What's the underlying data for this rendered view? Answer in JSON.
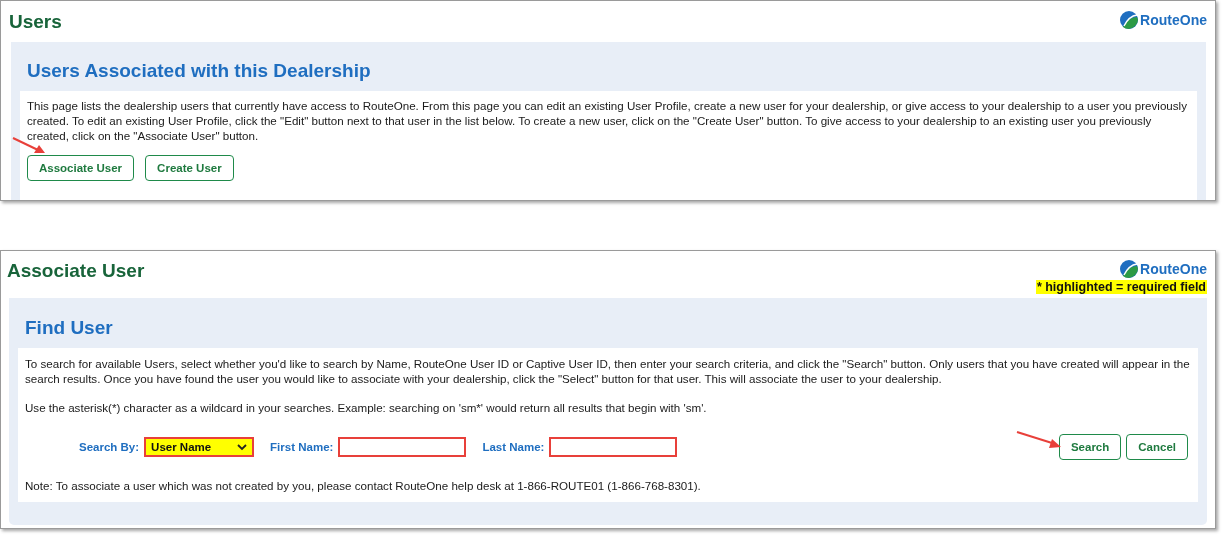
{
  "users_panel": {
    "title": "Users",
    "brand": "RouteOne",
    "section_title": "Users Associated with this Dealership",
    "description": "This page lists the dealership users that currently have access to RouteOne. From this page you can edit an existing User Profile, create a new user for your dealership, or give access to your dealership to a user you previously created. To edit an existing User Profile, click the \"Edit\" button next to that user in the list below. To create a new user, click on the \"Create User\" button. To give access to your dealership to an existing user you previously created, click on the \"Associate User\" button.",
    "buttons": [
      "Associate User",
      "Create User"
    ]
  },
  "associate_panel": {
    "title": "Associate User",
    "brand": "RouteOne",
    "required_note": "* highlighted = required field",
    "section_title": "Find User",
    "paragraphs": [
      "To search for available Users, select whether you'd like to search by Name, RouteOne User ID or Captive User ID, then enter your search criteria, and click the \"Search\" button. Only users that you have created will appear in the search results. Once you have found the user you would like to associate with your dealership, click the \"Select\" button for that user. This will associate the user to your dealership.",
      "Use the asterisk(*) character as a wildcard in your searches. Example: searching on 'sm*' would return all results that begin with 'sm'."
    ],
    "fields": [
      {
        "label": "Search By:",
        "kind": "select",
        "value": "User Name",
        "required": true
      },
      {
        "label": "First Name:",
        "kind": "text",
        "required": true
      },
      {
        "label": "Last Name:",
        "kind": "text",
        "required": true
      }
    ],
    "buttons": [
      "Search",
      "Cancel"
    ],
    "note": "Note: To associate a user which was not created by you, please contact RouteOne help desk at 1-866-ROUTE01 (1-866-768-8301)."
  }
}
